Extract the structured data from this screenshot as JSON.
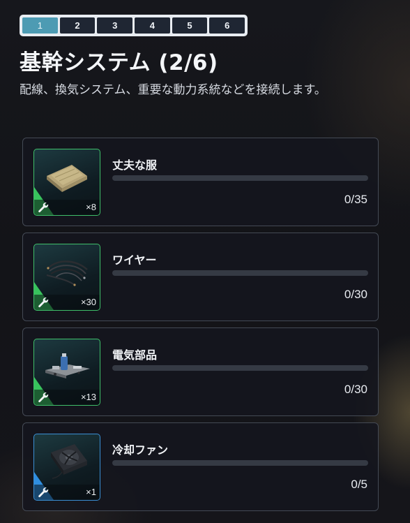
{
  "stepper": {
    "steps": [
      "1",
      "2",
      "3",
      "4",
      "5",
      "6"
    ],
    "active_index": 0
  },
  "header": {
    "title": "基幹システム (2/6)",
    "description": "配線、換気システム、重要な動力系統などを接続します。"
  },
  "requirements": [
    {
      "name": "丈夫な服",
      "quantity": "×8",
      "progress": "0/35",
      "progress_fraction": 0,
      "icon": "fabric-icon",
      "accent": "#38c25c"
    },
    {
      "name": "ワイヤー",
      "quantity": "×30",
      "progress": "0/30",
      "progress_fraction": 0,
      "icon": "wires-icon",
      "accent": "#38c25c"
    },
    {
      "name": "電気部品",
      "quantity": "×13",
      "progress": "0/30",
      "progress_fraction": 0,
      "icon": "electrical-parts-icon",
      "accent": "#38c25c"
    },
    {
      "name": "冷却ファン",
      "quantity": "×1",
      "progress": "0/5",
      "progress_fraction": 0,
      "icon": "cooling-fan-icon",
      "accent": "#2f8ee0"
    }
  ],
  "colors": {
    "step_active": "#4d9bb3",
    "step_inactive": "#1f2633",
    "accent_green": "#38c25c",
    "accent_blue": "#2f8ee0"
  }
}
